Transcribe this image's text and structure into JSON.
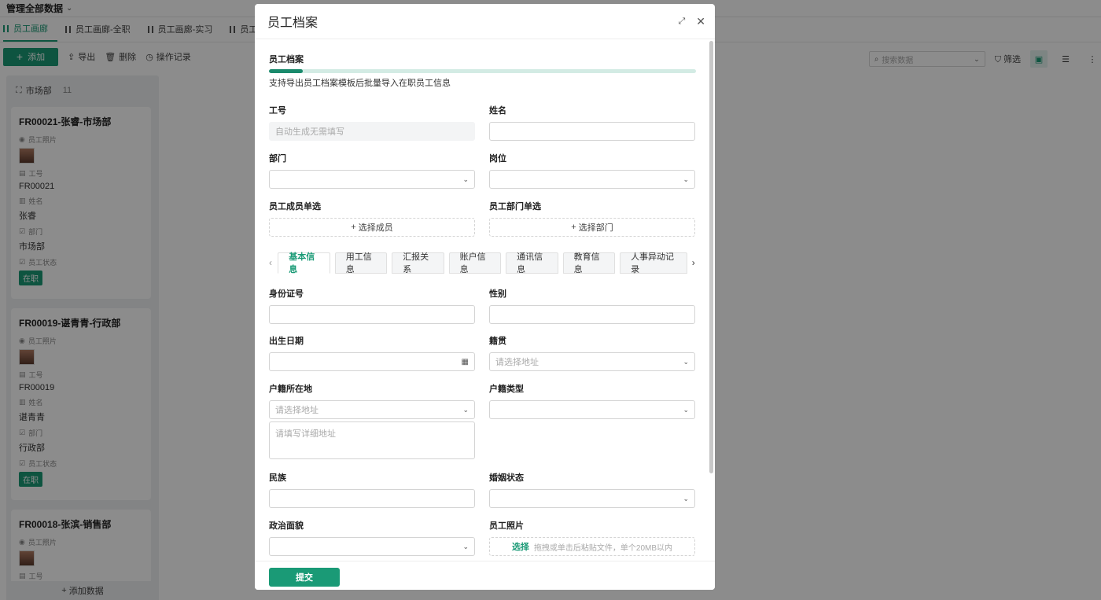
{
  "app": {
    "title": "管理全部数据",
    "tabs": [
      {
        "label": "员工画廊"
      },
      {
        "label": "员工画廊-全职"
      },
      {
        "label": "员工画廊-实习"
      },
      {
        "label": "员工"
      }
    ],
    "toolbar": {
      "add": "添加",
      "export": "导出",
      "delete": "删除",
      "log": "操作记录"
    },
    "search_placeholder": "搜索数据",
    "filter": "筛选",
    "board": {
      "group": "市场部",
      "count": "11",
      "add_data": "添加数据",
      "cards": [
        {
          "title": "FR00021-张睿-市场部",
          "photo_label": "员工照片",
          "id_label": "工号",
          "id": "FR00021",
          "name_label": "姓名",
          "name": "张睿",
          "dept_label": "部门",
          "dept": "市场部",
          "status_label": "员工状态",
          "status": "在职"
        },
        {
          "title": "FR00019-谌青青-行政部",
          "photo_label": "员工照片",
          "id_label": "工号",
          "id": "FR00019",
          "name_label": "姓名",
          "name": "谌青青",
          "dept_label": "部门",
          "dept": "行政部",
          "status_label": "员工状态",
          "status": "在职"
        },
        {
          "title": "FR00018-张滨-销售部",
          "photo_label": "员工照片",
          "id_label": "工号"
        }
      ]
    }
  },
  "modal": {
    "title": "员工档案",
    "section_title": "员工档案",
    "progress": 0.08,
    "section_desc": "支持导出员工档案模板后批量导入在职员工信息",
    "fields": {
      "emp_no": {
        "label": "工号",
        "placeholder": "自动生成无需填写"
      },
      "name": {
        "label": "姓名"
      },
      "dept": {
        "label": "部门"
      },
      "post": {
        "label": "岗位"
      },
      "member": {
        "label": "员工成员单选",
        "button": "选择成员"
      },
      "dept_single": {
        "label": "员工部门单选",
        "button": "选择部门"
      },
      "id_card": {
        "label": "身份证号"
      },
      "gender": {
        "label": "性别"
      },
      "birthday": {
        "label": "出生日期"
      },
      "native": {
        "label": "籍贯",
        "placeholder": "请选择地址"
      },
      "hukou_loc": {
        "label": "户籍所在地",
        "placeholder": "请选择地址",
        "detail_placeholder": "请填写详细地址"
      },
      "hukou_type": {
        "label": "户籍类型"
      },
      "ethnic": {
        "label": "民族"
      },
      "marital": {
        "label": "婚姻状态"
      },
      "political": {
        "label": "政治面貌"
      },
      "photo": {
        "label": "员工照片",
        "pick": "选择",
        "hint": "拖拽或单击后粘贴文件，单个20MB以内"
      }
    },
    "form_tabs": [
      "基本信息",
      "用工信息",
      "汇报关系",
      "账户信息",
      "通讯信息",
      "教育信息",
      "人事异动记录"
    ],
    "submit": "提交"
  },
  "colors": {
    "accent": "#1a9a76"
  }
}
